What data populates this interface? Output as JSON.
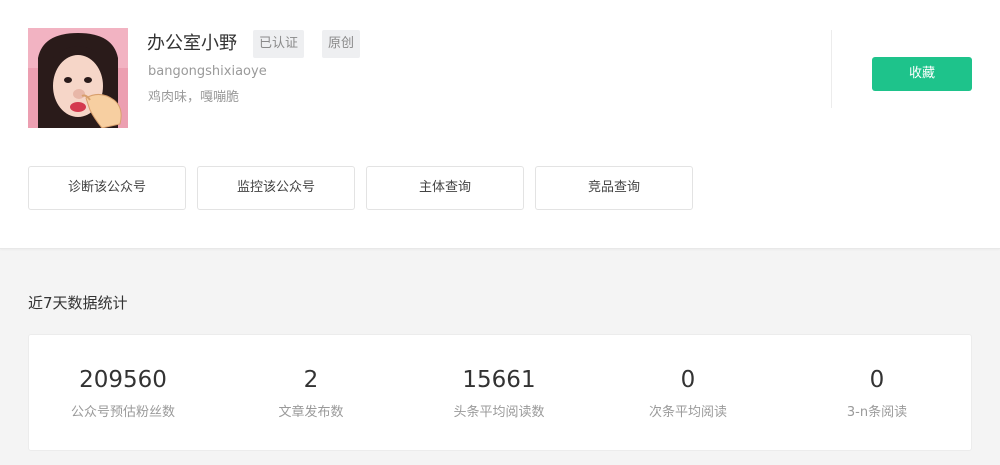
{
  "profile": {
    "name": "办公室小野",
    "tags": {
      "verified": "已认证",
      "original": "原创"
    },
    "account_id": "bangongshixiaoye",
    "description": "鸡肉味，嘎嘣脆",
    "favorite_label": "收藏"
  },
  "actions": [
    "诊断该公众号",
    "监控该公众号",
    "主体查询",
    "竞品查询"
  ],
  "stats_section": {
    "title": "近7天数据统计",
    "items": [
      {
        "value": "209560",
        "label": "公众号预估粉丝数"
      },
      {
        "value": "2",
        "label": "文章发布数"
      },
      {
        "value": "15661",
        "label": "头条平均阅读数"
      },
      {
        "value": "0",
        "label": "次条平均阅读"
      },
      {
        "value": "0",
        "label": "3-n条阅读"
      }
    ]
  },
  "colors": {
    "accent": "#1ec38b",
    "page_bg": "#f4f4f4"
  }
}
